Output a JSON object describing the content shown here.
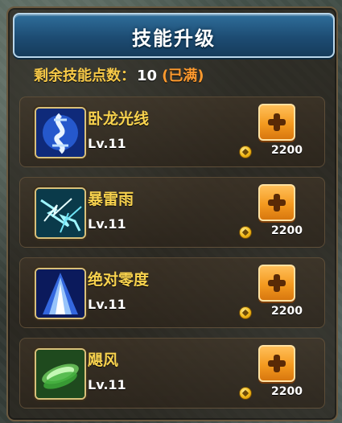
{
  "title": "技能升级",
  "points": {
    "label": "剩余技能点数：",
    "value": "10",
    "status": "(已满)"
  },
  "colors": {
    "title_bg": "#1d4c73",
    "gold_text": "#f8d24e",
    "status_orange": "#ff9a2e",
    "button_orange": "#f49a1f"
  },
  "skills": [
    {
      "name": "卧龙光线",
      "level": "Lv.11",
      "cost": "2200",
      "icon": "dragon-light-icon"
    },
    {
      "name": "暴雷雨",
      "level": "Lv.11",
      "cost": "2200",
      "icon": "thunderstorm-icon"
    },
    {
      "name": "绝对零度",
      "level": "Lv.11",
      "cost": "2200",
      "icon": "absolute-zero-icon"
    },
    {
      "name": "飓风",
      "level": "Lv.11",
      "cost": "2200",
      "icon": "hurricane-icon"
    }
  ]
}
